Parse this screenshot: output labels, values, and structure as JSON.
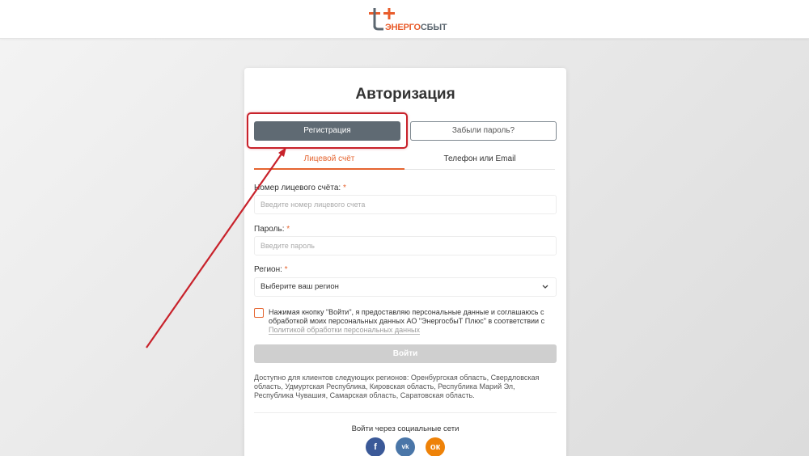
{
  "header": {
    "logo": {
      "brand_part1": "ЭНЕРГО",
      "brand_part2": "СБЫТ",
      "icon": "tt-logo-icon"
    }
  },
  "auth": {
    "title": "Авторизация",
    "register_label": "Регистрация",
    "forgot_label": "Забыли пароль?",
    "tabs": [
      {
        "label": "Лицевой счёт",
        "active": true
      },
      {
        "label": "Телефон или Email",
        "active": false
      }
    ],
    "fields": {
      "account": {
        "label": "Номер лицевого счёта:",
        "required_mark": "*",
        "placeholder": "Введите номер лицевого счета",
        "value": ""
      },
      "password": {
        "label": "Пароль:",
        "required_mark": "*",
        "placeholder": "Введите пароль",
        "value": ""
      },
      "region": {
        "label": "Регион:",
        "required_mark": "*",
        "selected": "Выберите ваш регион"
      }
    },
    "consent": {
      "checked": false,
      "text": "Нажимая кнопку \"Войти\", я предоставляю персональные данные и соглашаюсь с обработкой моих персональных данных АО \"ЭнергосбыТ Плюс\" в соответствии с",
      "link_text": "Политикой обработки персональных данных"
    },
    "login_label": "Войти",
    "regions_note": "Доступно для клиентов следующих регионов: Оренбургская область, Свердловская область, Удмуртская Республика, Кировская область, Республика Марий Эл, Республика Чувашия, Самарская область, Саратовская область.",
    "social": {
      "title": "Войти через социальные сети",
      "items": [
        {
          "name": "facebook",
          "glyph": "f",
          "icon": "facebook-icon",
          "color": "#3b5998"
        },
        {
          "name": "vk",
          "glyph": "vk",
          "icon": "vk-icon",
          "color": "#4a76a8"
        },
        {
          "name": "odnoklassniki",
          "glyph": "ок",
          "icon": "odnoklassniki-icon",
          "color": "#ee8208"
        }
      ]
    }
  },
  "colors": {
    "accent": "#e5642f",
    "register_button": "#5f6a73",
    "highlight": "#c8222b",
    "login_disabled": "#cfcfcf"
  }
}
